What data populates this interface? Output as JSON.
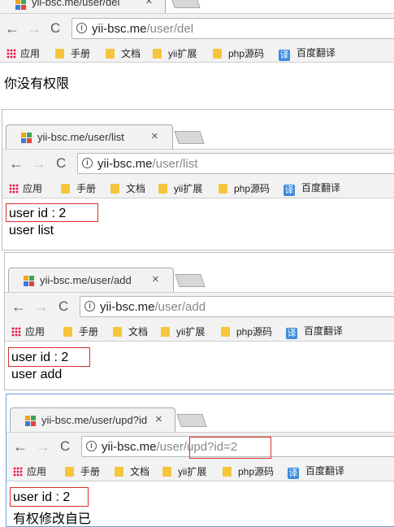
{
  "screens": [
    {
      "tab_title": "yii-bsc.me/user/del",
      "url_host": "yii-bsc.me",
      "url_path": "/user/del",
      "content": [
        "你没有权限"
      ]
    },
    {
      "tab_title": "yii-bsc.me/user/list",
      "url_host": "yii-bsc.me",
      "url_path": "/user/list",
      "content": [
        "user id : 2",
        "user list"
      ]
    },
    {
      "tab_title": "yii-bsc.me/user/add",
      "url_host": "yii-bsc.me",
      "url_path": "/user/add",
      "content": [
        "user id : 2",
        "user add"
      ]
    },
    {
      "tab_title": "yii-bsc.me/user/upd?id",
      "url_host": "yii-bsc.me",
      "url_path_a": "/user/",
      "url_path_b": "upd?id=2",
      "content": [
        "user id : 2",
        "有权修改自已"
      ]
    }
  ],
  "bookmarks": {
    "apps": "应用",
    "items": [
      "手册",
      "文档",
      "yii扩展",
      "php源码"
    ],
    "translate_badge": "译",
    "translate": "百度翻译"
  },
  "icons": {
    "info": "i",
    "close": "×",
    "back": "←",
    "forward": "→",
    "reload": "C"
  },
  "colors": {
    "highlight_border": "#d9312b",
    "chrome_bg": "#f2f2f2",
    "folder": "#f5c53c",
    "translate_bg": "#3c8bdc"
  }
}
